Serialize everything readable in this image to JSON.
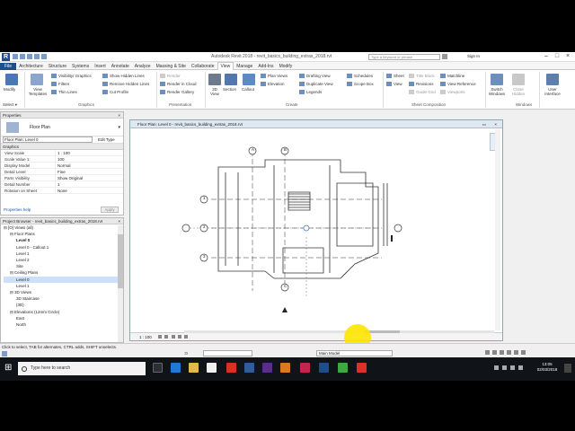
{
  "window": {
    "app_title": "Autodesk Revit 2018 - ",
    "file_title": "revit_basics_building_extras_2018.rvt",
    "search_placeholder": "Type a keyword or phrase",
    "sign_in": "Sign In"
  },
  "tabs": [
    "File",
    "Architecture",
    "Structure",
    "Systems",
    "Insert",
    "Annotate",
    "Analyze",
    "Massing & Site",
    "Collaborate",
    "View",
    "Manage",
    "Add-Ins",
    "Modify"
  ],
  "ribbon": {
    "modify": "Modify",
    "select": "Select ▾",
    "view_templates": "View Templates",
    "vis_graphics": "Visibility/ Graphics",
    "filters": "Filters",
    "thin_lines": "Thin Lines",
    "show_hidden": "Show Hidden Lines",
    "remove_hidden": "Remove Hidden Lines",
    "cut_profile": "Cut Profile",
    "render": "Render",
    "render_cloud": "Render in Cloud",
    "render_gallery": "Render Gallery",
    "view_3d": "3D View",
    "section": "Section",
    "callout": "Callout",
    "plan_views": "Plan Views",
    "elevation": "Elevation",
    "drafting_view": "Drafting View",
    "duplicate_view": "Duplicate View",
    "legends": "Legends",
    "schedules": "Schedules",
    "scope_box": "Scope Box",
    "sheet": "Sheet",
    "title_block": "Title Block",
    "revisions": "Revisions",
    "guide_grid": "Guide Grid",
    "view_btn": "View",
    "matchline": "Matchline",
    "view_reference": "View Reference",
    "viewports": "Viewports",
    "switch_windows": "Switch Windows",
    "close_hidden": "Close Hidden",
    "user_interface": "User Interface",
    "panels": {
      "graphics": "Graphics",
      "presentation": "Presentation",
      "create": "Create",
      "sheet_comp": "Sheet Composition",
      "windows": "Windows"
    }
  },
  "properties": {
    "title": "Properties",
    "type_name": "Floor Plan",
    "selector": "Floor Plan: Level 0",
    "edit_type": "Edit Type",
    "group": "Graphics",
    "rows": [
      [
        "View Scale",
        "1 : 100"
      ],
      [
        "Scale Value    1:",
        "100"
      ],
      [
        "Display Model",
        "Normal"
      ],
      [
        "Detail Level",
        "Fine"
      ],
      [
        "Parts Visibility",
        "Show Original"
      ],
      [
        "Detail Number",
        "1"
      ],
      [
        "Rotation on Sheet",
        "None"
      ]
    ],
    "help": "Properties help",
    "apply": "Apply"
  },
  "browser": {
    "title": "Project Browser - revit_basics_building_extras_2018.rvt",
    "items": [
      [
        "0",
        "⊟ [O] Views (all)"
      ],
      [
        "1",
        "⊟ Floor Plans"
      ],
      [
        "2",
        "Level 0"
      ],
      [
        "2",
        "Level 0 - Callout 1"
      ],
      [
        "2",
        "Level 1"
      ],
      [
        "2",
        "Level 2"
      ],
      [
        "2",
        "Site"
      ],
      [
        "1",
        "⊟ Ceiling Plans"
      ],
      [
        "2",
        "Level 0"
      ],
      [
        "2",
        "Level 1"
      ],
      [
        "1",
        "⊟ 3D Views"
      ],
      [
        "2",
        "3D Staircase"
      ],
      [
        "2",
        "{3D}"
      ],
      [
        "1",
        "⊟ Elevations (12mm Circle)"
      ],
      [
        "2",
        "East"
      ],
      [
        "2",
        "North"
      ]
    ]
  },
  "canvas": {
    "title": "Floor Plan: Level 0 - revit_basics_building_extras_2018.rvt",
    "scale": "1 : 100",
    "grid_labels": [
      "A",
      "B",
      "1",
      "2",
      "3",
      "C"
    ]
  },
  "status": {
    "hint": "Click to select, TAB for alternates, CTRL adds, SHIFT unselects.",
    "model": "Main Model",
    "zero": ":0"
  },
  "taskbar": {
    "search": "Type here to search",
    "time": "13:05",
    "date": "02/03/2018"
  }
}
